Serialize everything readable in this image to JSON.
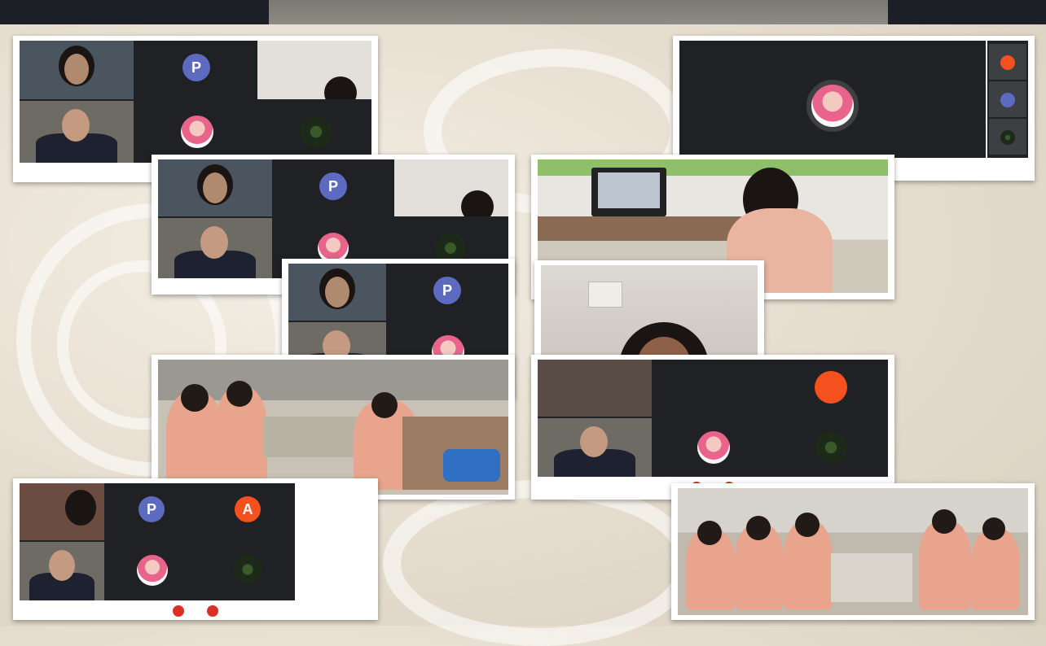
{
  "avatars": {
    "p": "P",
    "a": "A"
  },
  "colors": {
    "meet_background": "#202124",
    "tile": "#3c4043",
    "avatar_p": "#5c6bc0",
    "avatar_a": "#f4511e",
    "end_call": "#d93025"
  },
  "icons": [
    "end-call-icon",
    "mic-icon",
    "camera-icon"
  ]
}
